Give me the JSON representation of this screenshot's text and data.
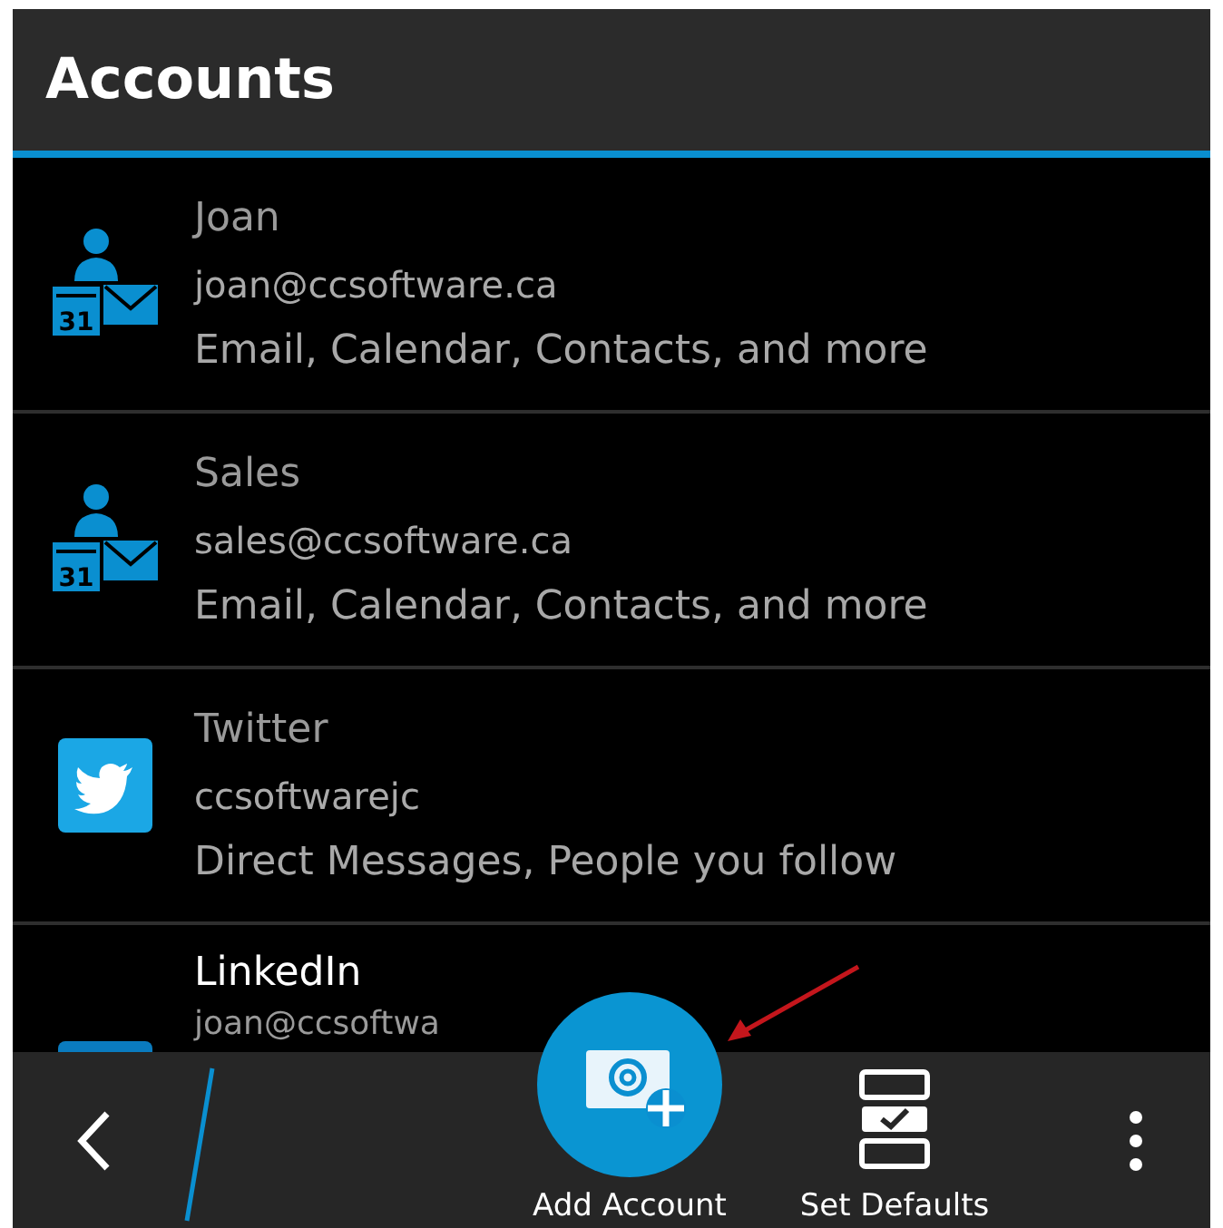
{
  "title": "Accounts",
  "accounts": [
    {
      "kind": "exchange",
      "icon_date": "31",
      "name": "Joan",
      "address": "joan@ccsoftware.ca",
      "services": "Email, Calendar, Contacts, and more"
    },
    {
      "kind": "exchange",
      "icon_date": "31",
      "name": "Sales",
      "address": "sales@ccsoftware.ca",
      "services": "Email, Calendar, Contacts, and more"
    },
    {
      "kind": "twitter",
      "name": "Twitter",
      "address": "ccsoftwarejc",
      "services": "Direct Messages, People you follow"
    },
    {
      "kind": "linkedin",
      "name": "LinkedIn",
      "address": "joan@ccsoftwa"
    }
  ],
  "actions": [
    {
      "label": "Add Account"
    },
    {
      "label": "Set Defaults"
    }
  ]
}
